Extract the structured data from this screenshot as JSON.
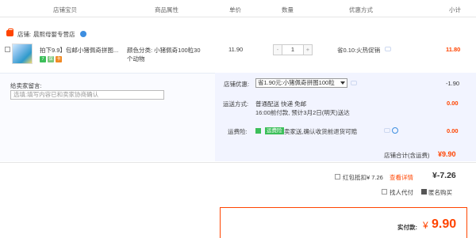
{
  "header": {
    "col_shop_item": "店铺宝贝",
    "col_attrs": "商品属性",
    "col_unit_price": "单价",
    "col_qty": "数量",
    "col_discount": "优惠方式",
    "col_subtotal": "小计"
  },
  "shop": {
    "label": "店铺:",
    "name": "晨熙母婴专营店"
  },
  "item": {
    "title": "拍下9.9】包邮小猪佩奇拼图...",
    "attr_line1": "颜色分类: 小猪佩奇100粒30",
    "attr_line2": "个动物",
    "unit_price": "11.90",
    "quantity": "1",
    "minus": "-",
    "plus": "+",
    "discount": "省0.10:火热促销",
    "subtotal": "11.80"
  },
  "message": {
    "label": "给卖家留言:",
    "placeholder": "选填:填写内容已和卖家协商确认"
  },
  "shop_discount": {
    "label": "店铺优惠:",
    "selected": "省1.90元:小猪佩奇拼图100粒",
    "amount": "-1.90"
  },
  "shipping": {
    "label": "运送方式:",
    "line1": "普通配送 快递 免邮",
    "line2": "16:00前付款, 预计3月2日(明天)送达",
    "amount": "0.00"
  },
  "insurance": {
    "label": "运费险:",
    "tag": "运费险",
    "text": "卖家送,确认收货前退货可赔",
    "amount": "0.00"
  },
  "shop_total": {
    "label": "店铺合计(含运费)",
    "amount": "¥9.90"
  },
  "redpacket": {
    "label": "红包抵扣¥ 7.26",
    "link": "查看详情",
    "amount": "¥-7.26"
  },
  "options": {
    "proxy_pay": "找人代付",
    "anonymous": "匿名购买"
  },
  "final": {
    "label": "实付款:",
    "currency": "¥",
    "amount": "9.90"
  },
  "colors": {
    "accent": "#ff4400",
    "green": "#3cbf5a",
    "blue": "#3d8ee0"
  }
}
